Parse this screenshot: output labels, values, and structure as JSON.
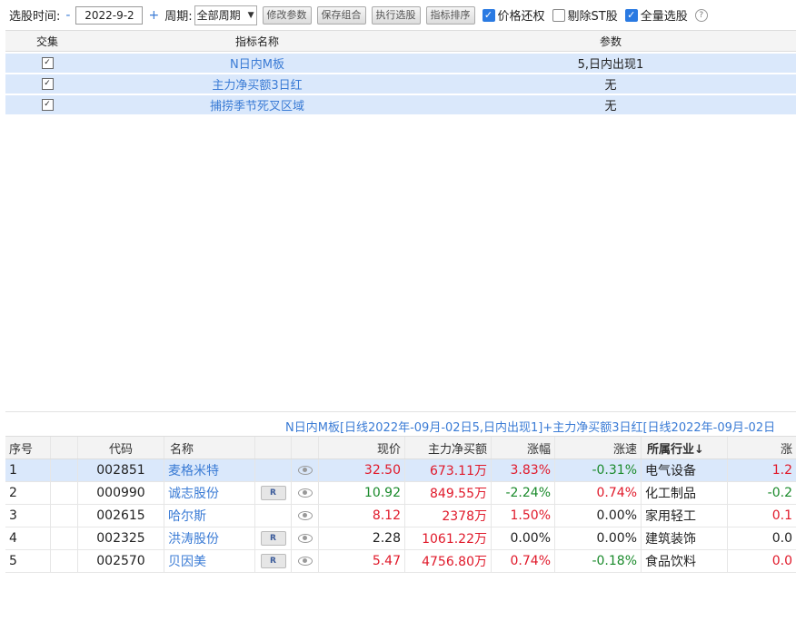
{
  "toolbar": {
    "date_label": "选股时间:",
    "minus": "-",
    "date_value": "2022-9-2",
    "plus": "+",
    "period_label": "周期:",
    "period_value": "全部周期",
    "buttons": [
      "修改参数",
      "保存组合",
      "执行选股",
      "指标排序"
    ],
    "checkboxes": [
      {
        "label": "价格还权",
        "checked": true
      },
      {
        "label": "剔除ST股",
        "checked": false
      },
      {
        "label": "全量选股",
        "checked": true
      }
    ],
    "help": "?"
  },
  "indicators": {
    "headers": [
      "交集",
      "指标名称",
      "参数"
    ],
    "rows": [
      {
        "checked": true,
        "name": "N日内M板",
        "param": "5,日内出现1"
      },
      {
        "checked": true,
        "name": "主力净买额3日红",
        "param": "无"
      },
      {
        "checked": true,
        "name": "捕捞季节死叉区域",
        "param": "无"
      }
    ]
  },
  "combo_text": "N日内M板[日线2022年-09月-02日5,日内出现1]+主力净买额3日红[日线2022年-09月-02日",
  "results": {
    "headers": [
      "序号",
      "",
      "代码",
      "名称",
      "",
      "",
      "现价",
      "主力净买额",
      "涨幅",
      "涨速",
      "所属行业↓",
      "涨"
    ],
    "rows": [
      {
        "no": "1",
        "code": "002851",
        "name": "麦格米特",
        "r": "",
        "price": "32.50",
        "flow": "673.11万",
        "chg": "3.83%",
        "spd": "-0.31%",
        "ind": "电气设备",
        "more": "1.2",
        "price_c": "red",
        "flow_c": "red",
        "chg_c": "red",
        "spd_c": "green",
        "more_c": "red"
      },
      {
        "no": "2",
        "code": "000990",
        "name": "诚志股份",
        "r": "R",
        "price": "10.92",
        "flow": "849.55万",
        "chg": "-2.24%",
        "spd": "0.74%",
        "ind": "化工制品",
        "more": "-0.2",
        "price_c": "green",
        "flow_c": "red",
        "chg_c": "green",
        "spd_c": "red",
        "more_c": "green"
      },
      {
        "no": "3",
        "code": "002615",
        "name": "哈尔斯",
        "r": "",
        "price": "8.12",
        "flow": "2378万",
        "chg": "1.50%",
        "spd": "0.00%",
        "ind": "家用轻工",
        "more": "0.1",
        "price_c": "red",
        "flow_c": "red",
        "chg_c": "red",
        "spd_c": "",
        "more_c": "red"
      },
      {
        "no": "4",
        "code": "002325",
        "name": "洪涛股份",
        "r": "R",
        "price": "2.28",
        "flow": "1061.22万",
        "chg": "0.00%",
        "spd": "0.00%",
        "ind": "建筑装饰",
        "more": "0.0",
        "price_c": "",
        "flow_c": "red",
        "chg_c": "",
        "spd_c": "",
        "more_c": ""
      },
      {
        "no": "5",
        "code": "002570",
        "name": "贝因美",
        "r": "R",
        "price": "5.47",
        "flow": "4756.80万",
        "chg": "0.74%",
        "spd": "-0.18%",
        "ind": "食品饮料",
        "more": "0.0",
        "price_c": "red",
        "flow_c": "red",
        "chg_c": "red",
        "spd_c": "green",
        "more_c": "red"
      }
    ]
  }
}
